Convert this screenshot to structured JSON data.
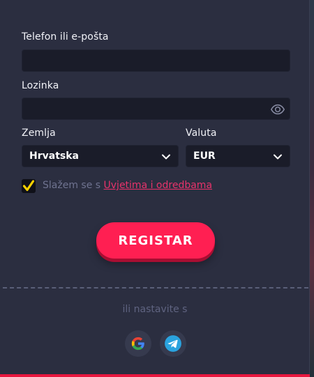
{
  "form": {
    "phone_label": "Telefon ili e-pošta",
    "phone_value": "",
    "password_label": "Lozinka",
    "password_value": "",
    "country_label": "Zemlja",
    "country_value": "Hrvatska",
    "currency_label": "Valuta",
    "currency_value": "EUR",
    "terms_prefix": "Slažem se s ",
    "terms_link": "Uvjetima i odredbama",
    "terms_checked": true,
    "register_label": "REGISTAR"
  },
  "social": {
    "continue_text": "ili nastavite s",
    "providers": [
      {
        "name": "google",
        "icon": "google-icon"
      },
      {
        "name": "telegram",
        "icon": "telegram-icon"
      }
    ]
  },
  "colors": {
    "panel_bg": "#2b2e40",
    "input_bg": "#1a1c29",
    "accent": "#ff1f52",
    "check_yellow": "#f6d000",
    "link_pink": "#e8336b"
  }
}
